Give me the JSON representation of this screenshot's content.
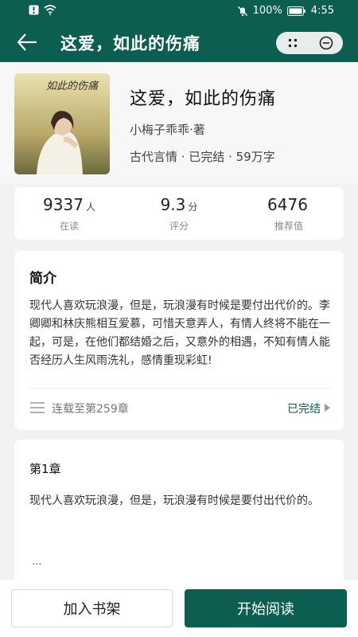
{
  "status_bar": {
    "battery": "100%",
    "time": "4:55"
  },
  "nav": {
    "title": "这爱，如此的伤痛"
  },
  "book": {
    "title": "这爱，如此的伤痛",
    "author": "小梅子乖乖·著",
    "meta": "古代言情 · 已完结 · 59万字",
    "cover_text": "如此的伤痛"
  },
  "stats": [
    {
      "value": "9337",
      "unit": "人",
      "label": "在读"
    },
    {
      "value": "9.3",
      "unit": "分",
      "label": "评分"
    },
    {
      "value": "6476",
      "unit": "",
      "label": "推荐值"
    }
  ],
  "intro": {
    "heading": "简介",
    "text": "现代人喜欢玩浪漫，但是，玩浪漫有时候是要付出代价的。李卿卿和林庆熊相互爱慕，可惜天意弄人，有情人终将不能在一起，可是，在他们都结婚之后，又意外的相遇，不知有情人能否经历人生风雨洗礼，感情重现彩虹!",
    "serial": "连载至第259章",
    "status": "已完结"
  },
  "chapter": {
    "title": "第1章",
    "text": "现代人喜欢玩浪漫，但是，玩浪漫有时候是要付出代价的。",
    "ellipsis": "..."
  },
  "actions": {
    "add_shelf": "加入书架",
    "start_reading": "开始阅读"
  },
  "colors": {
    "primary": "#0c5e51",
    "background": "#f2f2f2"
  }
}
